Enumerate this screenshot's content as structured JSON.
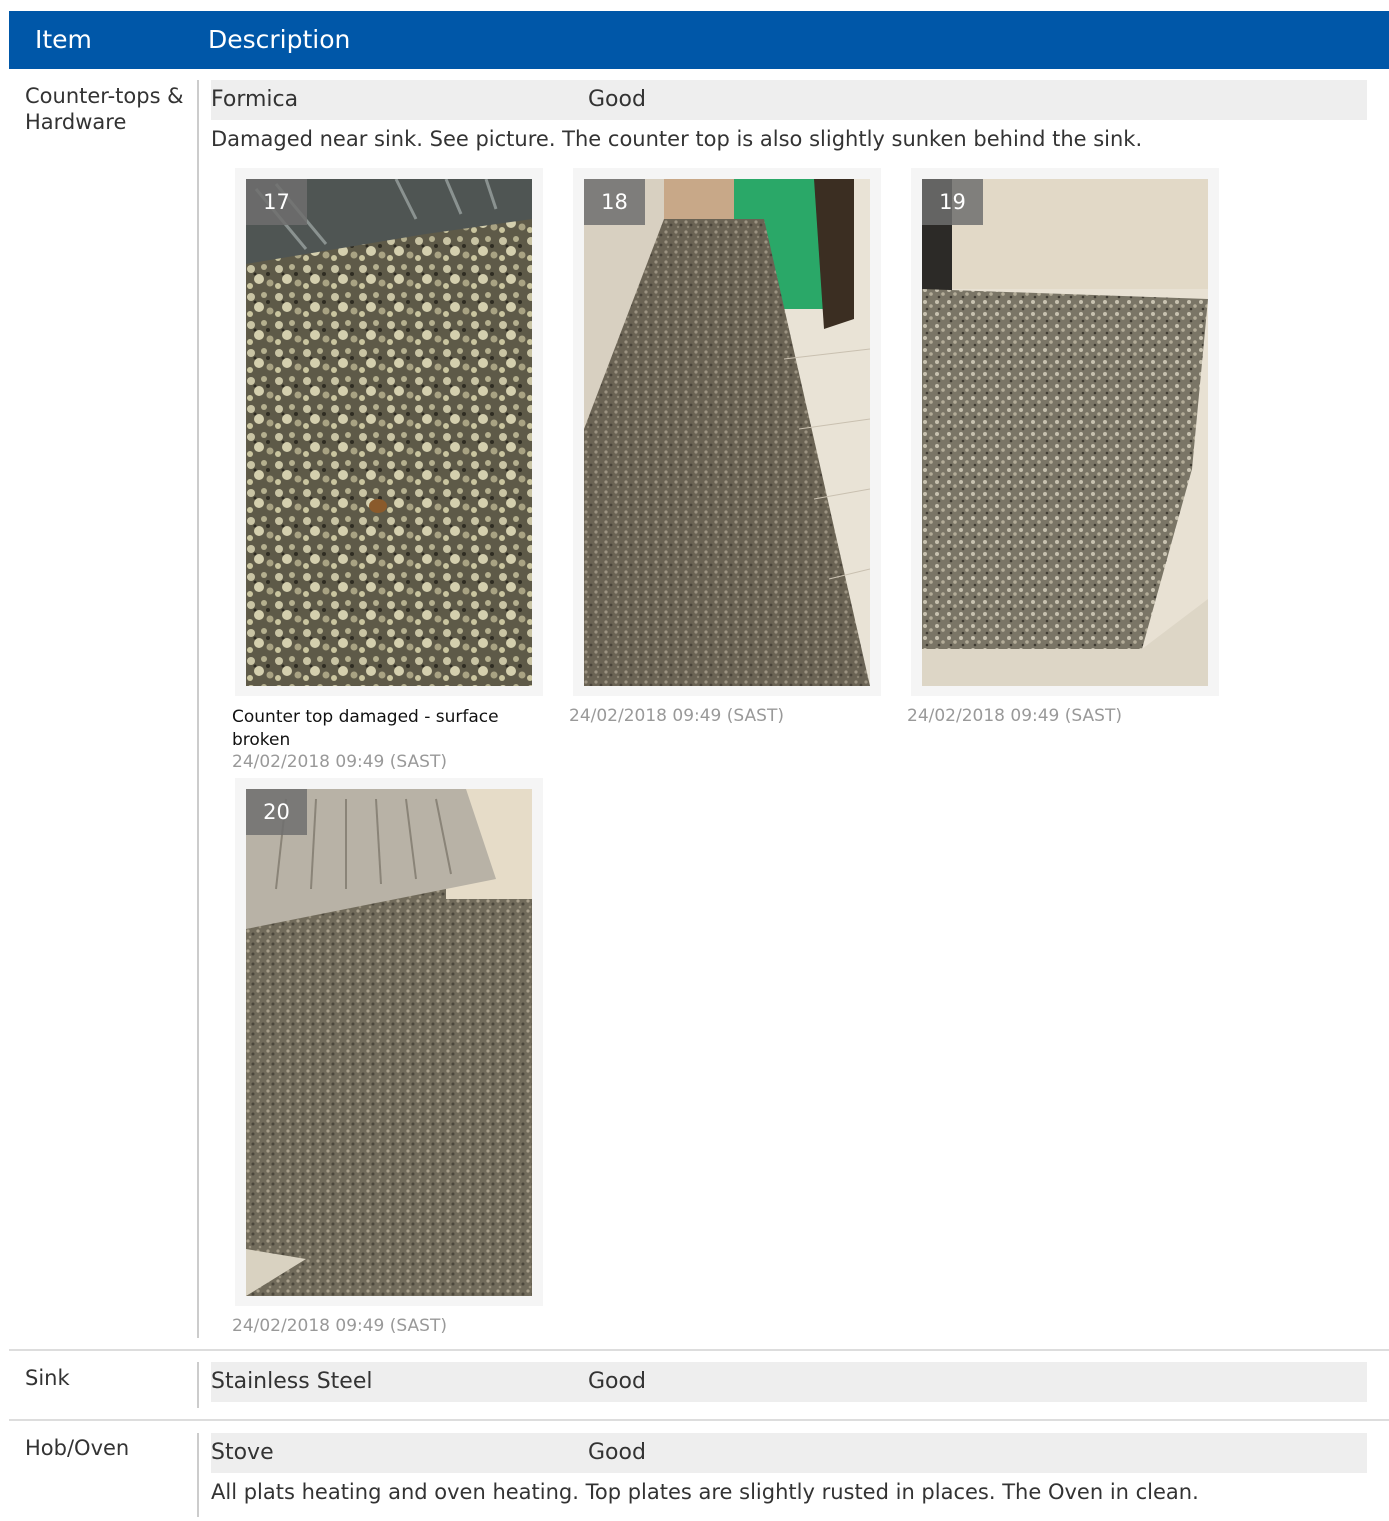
{
  "header": {
    "item": "Item",
    "description": "Description"
  },
  "rows": [
    {
      "item": "Counter-tops & Hardware",
      "material": "Formica",
      "condition": "Good",
      "comment": "Damaged near sink. See picture. The counter top is also slightly sunken behind the sink.",
      "photos": [
        {
          "number": "17",
          "caption": "Counter top damaged - surface broken",
          "timestamp": "24/02/2018 09:49 (SAST)"
        },
        {
          "number": "18",
          "caption": "",
          "timestamp": "24/02/2018 09:49 (SAST)"
        },
        {
          "number": "19",
          "caption": "",
          "timestamp": "24/02/2018 09:49 (SAST)"
        },
        {
          "number": "20",
          "caption": "",
          "timestamp": "24/02/2018 09:49 (SAST)"
        }
      ]
    },
    {
      "item": "Sink",
      "material": "Stainless Steel",
      "condition": "Good",
      "comment": ""
    },
    {
      "item": "Hob/Oven",
      "material": "Stove",
      "condition": "Good",
      "comment": "All plats heating and oven heating. Top plates are slightly rusted in places. The Oven in clean."
    }
  ],
  "colors": {
    "header_bg": "#0057a8",
    "header_text": "#ffffff",
    "condition_bar_bg": "#eeeeee",
    "timestamp_text": "#999999"
  }
}
